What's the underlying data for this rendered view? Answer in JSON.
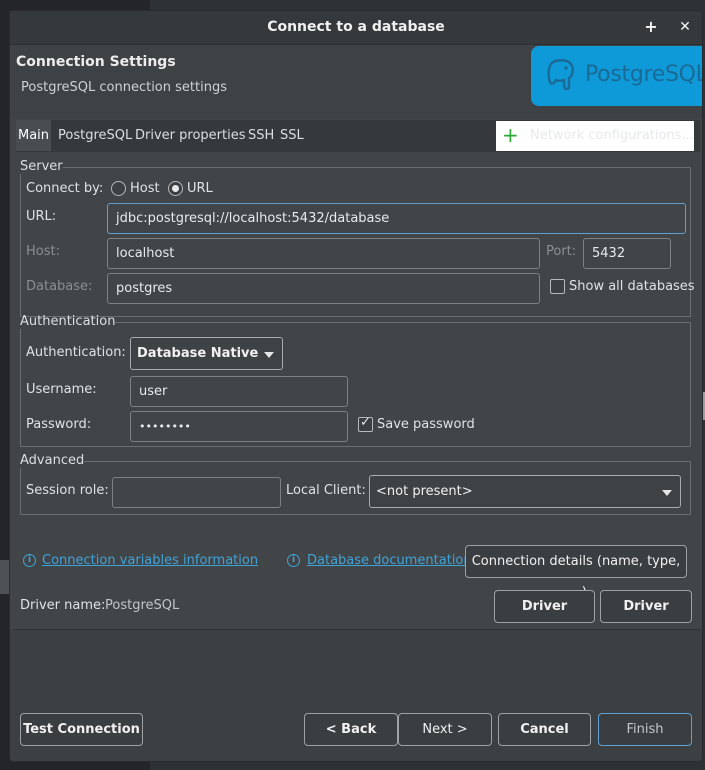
{
  "window": {
    "title": "Connect to a database"
  },
  "titlebar": {
    "plus": "+",
    "close": "✕"
  },
  "header": {
    "title": "Connection Settings",
    "subtitle": "PostgreSQL connection settings",
    "logo_text": "PostgreSQL"
  },
  "tabs": [
    {
      "label": "Main",
      "active": true
    },
    {
      "label": "PostgreSQL",
      "active": false
    },
    {
      "label": "Driver properties",
      "active": false
    },
    {
      "label": "SSH",
      "active": false
    },
    {
      "label": "SSL",
      "active": false
    }
  ],
  "network": {
    "label": "Network configurations..."
  },
  "server": {
    "legend": "Server",
    "connect_by_label": "Connect by:",
    "host_option": "Host",
    "url_option": "URL",
    "url_label": "URL:",
    "url_value": "jdbc:postgresql://localhost:5432/database",
    "host_label": "Host:",
    "host_value": "localhost",
    "port_label": "Port:",
    "port_value": "5432",
    "database_label": "Database:",
    "database_value": "postgres",
    "show_all_label": "Show all databases"
  },
  "auth": {
    "legend": "Authentication",
    "auth_label": "Authentication:",
    "auth_value": "Database Native",
    "username_label": "Username:",
    "username_value": "user",
    "password_label": "Password:",
    "password_value": "••••••••",
    "save_password_label": "Save password"
  },
  "advanced": {
    "legend": "Advanced",
    "session_role_label": "Session role:",
    "session_role_value": "",
    "local_client_label": "Local Client:",
    "local_client_value": "<not present>"
  },
  "links": {
    "conn_vars": "Connection variables information",
    "db_docs": "Database documentation",
    "conn_details": "Connection details (name, type, ... )"
  },
  "driver": {
    "name_label": "Driver name:",
    "name_value": "PostgreSQL",
    "settings_button": "Driver Settings",
    "license_button": "Driver license"
  },
  "footer": {
    "test_connection": "Test Connection ...",
    "back": "< Back",
    "next": "Next >",
    "cancel": "Cancel",
    "finish": "Finish"
  },
  "colors": {
    "dialog_bg": "#414548",
    "accent": "#3fa3d8",
    "logo_bg": "#0e9ad8"
  }
}
